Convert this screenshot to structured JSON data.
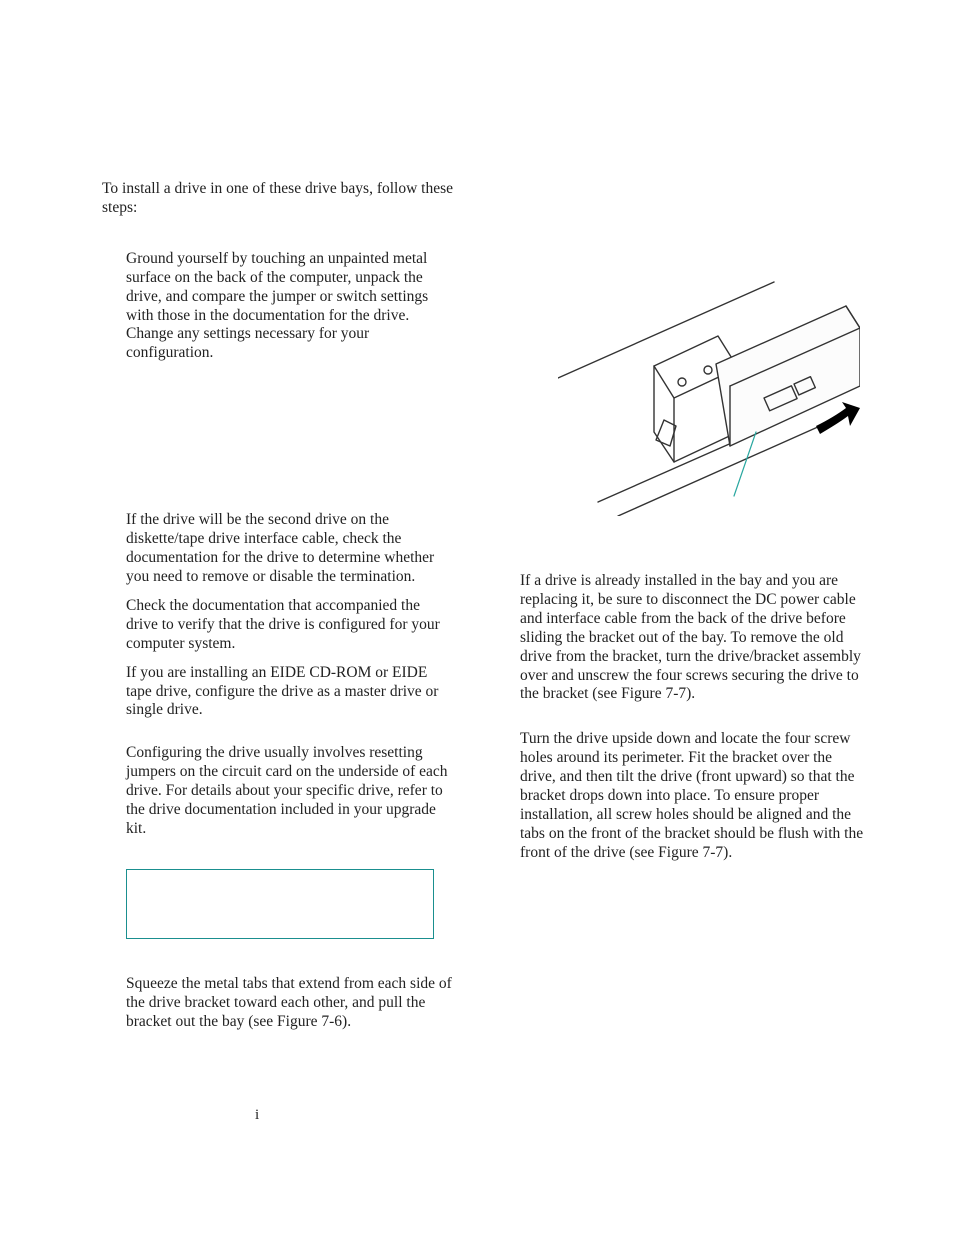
{
  "intro": "To install a drive in one of these drive bays, follow these steps:",
  "step1": "Ground yourself by touching an unpainted metal surface on the back of the computer, unpack the drive, and compare the jumper or switch settings with those in the documentation for the drive. Change any settings necessary for your configuration.",
  "step2a": "If the drive will be the second drive on the diskette/tape drive interface cable, check the documentation for the drive to determine whether you need to remove or disable the termination.",
  "step2b": "Check the documentation that accompanied the drive to verify that the drive is configured for your computer system.",
  "step2c": "If you are installing an EIDE CD-ROM or EIDE tape drive, configure the drive as a master drive or single drive.",
  "configuring": "Configuring the drive usually involves resetting jumpers on the circuit card on the underside of each drive. For details about your specific drive, refer to the drive documentation included in your upgrade kit.",
  "squeeze": "Squeeze the metal tabs that extend from each side of the drive bracket toward each other, and pull the bracket out the bay (see Figure 7-6).",
  "dot": "i",
  "note": "If a drive is already installed in the bay and you are replacing it, be sure to disconnect the DC power cable and interface cable from the back of the drive before sliding the bracket out of the bay. To remove the old drive from the bracket, turn the drive/bracket assembly over and unscrew the four screws securing the drive to the bracket (see Figure 7-7).",
  "turn": "Turn the drive upside down and locate the four screw holes around its perimeter. Fit the bracket over the drive, and then tilt the drive (front upward) so that the bracket drops down into place. To ensure proper installation, all screw holes should be aligned and the tabs on the front of the bracket should be flush with the front of the drive (see Figure 7-7).",
  "figure_name": "drive-bracket-removal-illustration"
}
